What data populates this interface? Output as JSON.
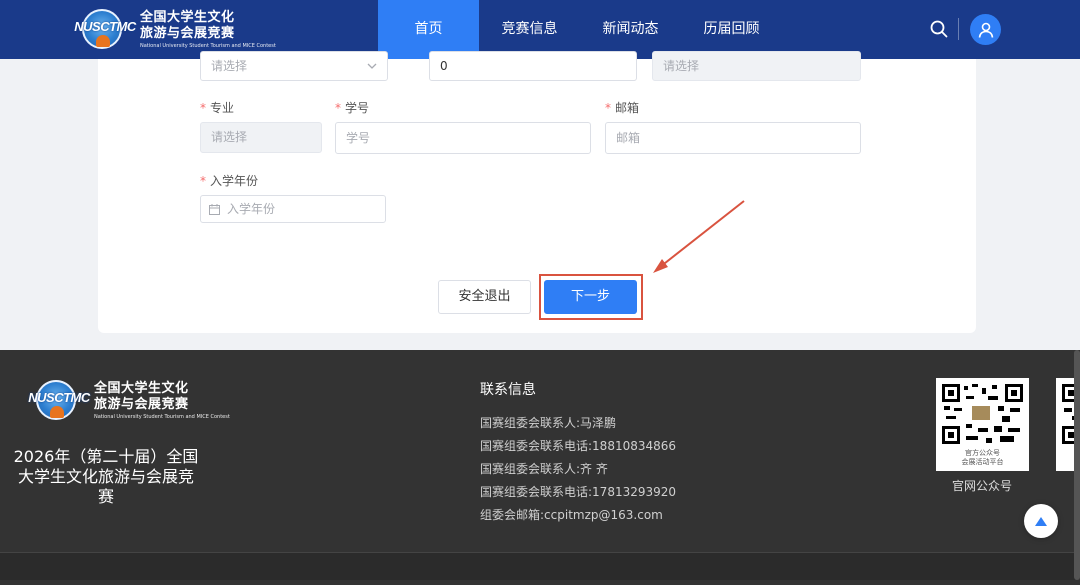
{
  "header": {
    "logo_abbr": "NUSCTMC",
    "logo_line1": "全国大学生文化",
    "logo_line2": "旅游与会展竞赛",
    "logo_tagline": "National University Student Tourism and MICE Contest",
    "nav": [
      {
        "label": "首页",
        "active": true
      },
      {
        "label": "竞赛信息",
        "active": false
      },
      {
        "label": "新闻动态",
        "active": false
      },
      {
        "label": "历届回顾",
        "active": false
      }
    ],
    "search_icon": "search-icon",
    "avatar_icon": "user-icon"
  },
  "form": {
    "row0": {
      "select_placeholder": "请选择",
      "number_value": "0",
      "disabled_placeholder": "请选择"
    },
    "major": {
      "required": "*",
      "label": "专业",
      "placeholder": "请选择"
    },
    "student_id": {
      "required": "*",
      "label": "学号",
      "placeholder": "学号"
    },
    "email": {
      "required": "*",
      "label": "邮箱",
      "placeholder": "邮箱"
    },
    "enroll_year": {
      "required": "*",
      "label": "入学年份",
      "placeholder": "入学年份"
    },
    "exit_button": "安全退出",
    "next_button": "下一步"
  },
  "annotation": {
    "color": "#d9533f"
  },
  "footer": {
    "logo_abbr": "NUSCTMC",
    "logo_line1": "全国大学生文化",
    "logo_line2": "旅游与会展竞赛",
    "logo_tagline": "National University Student Tourism and MICE Contest",
    "title_line1": "2026年（第二十届）全国",
    "title_line2": "大学生文化旅游与会展竞",
    "title_line3": "赛",
    "contact_heading": "联系信息",
    "contacts": [
      "国赛组委会联系人:马泽鹏",
      "国赛组委会联系电话:18810834866",
      "国赛组委会联系人:齐 齐",
      "国赛组委会联系电话:17813293920",
      "组委会邮箱:ccpitmzp@163.com"
    ],
    "qr1_inner_line1": "官方公众号",
    "qr1_inner_line2": "会展活动平台",
    "qr1_caption": "官网公众号"
  },
  "colors": {
    "header_bg": "#1a3a8a",
    "accent": "#2f7ef5",
    "footer_bg": "#333333",
    "required": "#f56c6c"
  }
}
